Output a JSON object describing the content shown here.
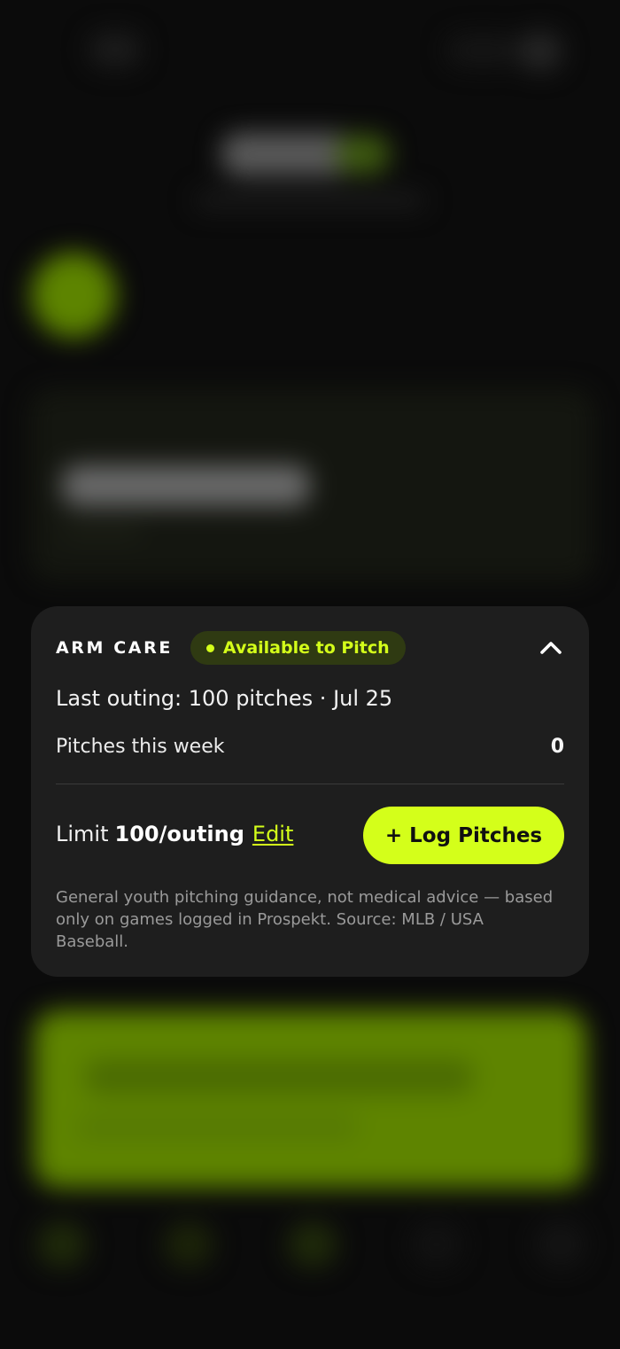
{
  "arm_care": {
    "section_title": "ARM CARE",
    "status": "Available to Pitch",
    "last_outing": "Last outing: 100 pitches · Jul 25",
    "pitches_this_week_label": "Pitches this week",
    "pitches_this_week_value": "0",
    "limit_prefix": "Limit",
    "limit_value": "100/outing",
    "edit_label": "Edit",
    "log_button_label": "+ Log Pitches",
    "disclaimer": "General youth pitching guidance, not medical advice — based only on games logged in Prospekt. Source: MLB / USA Baseball."
  },
  "colors": {
    "accent": "#d4ff1a",
    "card_background": "#1e1e1e",
    "page_background": "#0b0b0b",
    "badge_background": "#2f3a12"
  },
  "icons": {
    "collapse": "chevron-up-icon",
    "status": "status-dot-icon"
  }
}
